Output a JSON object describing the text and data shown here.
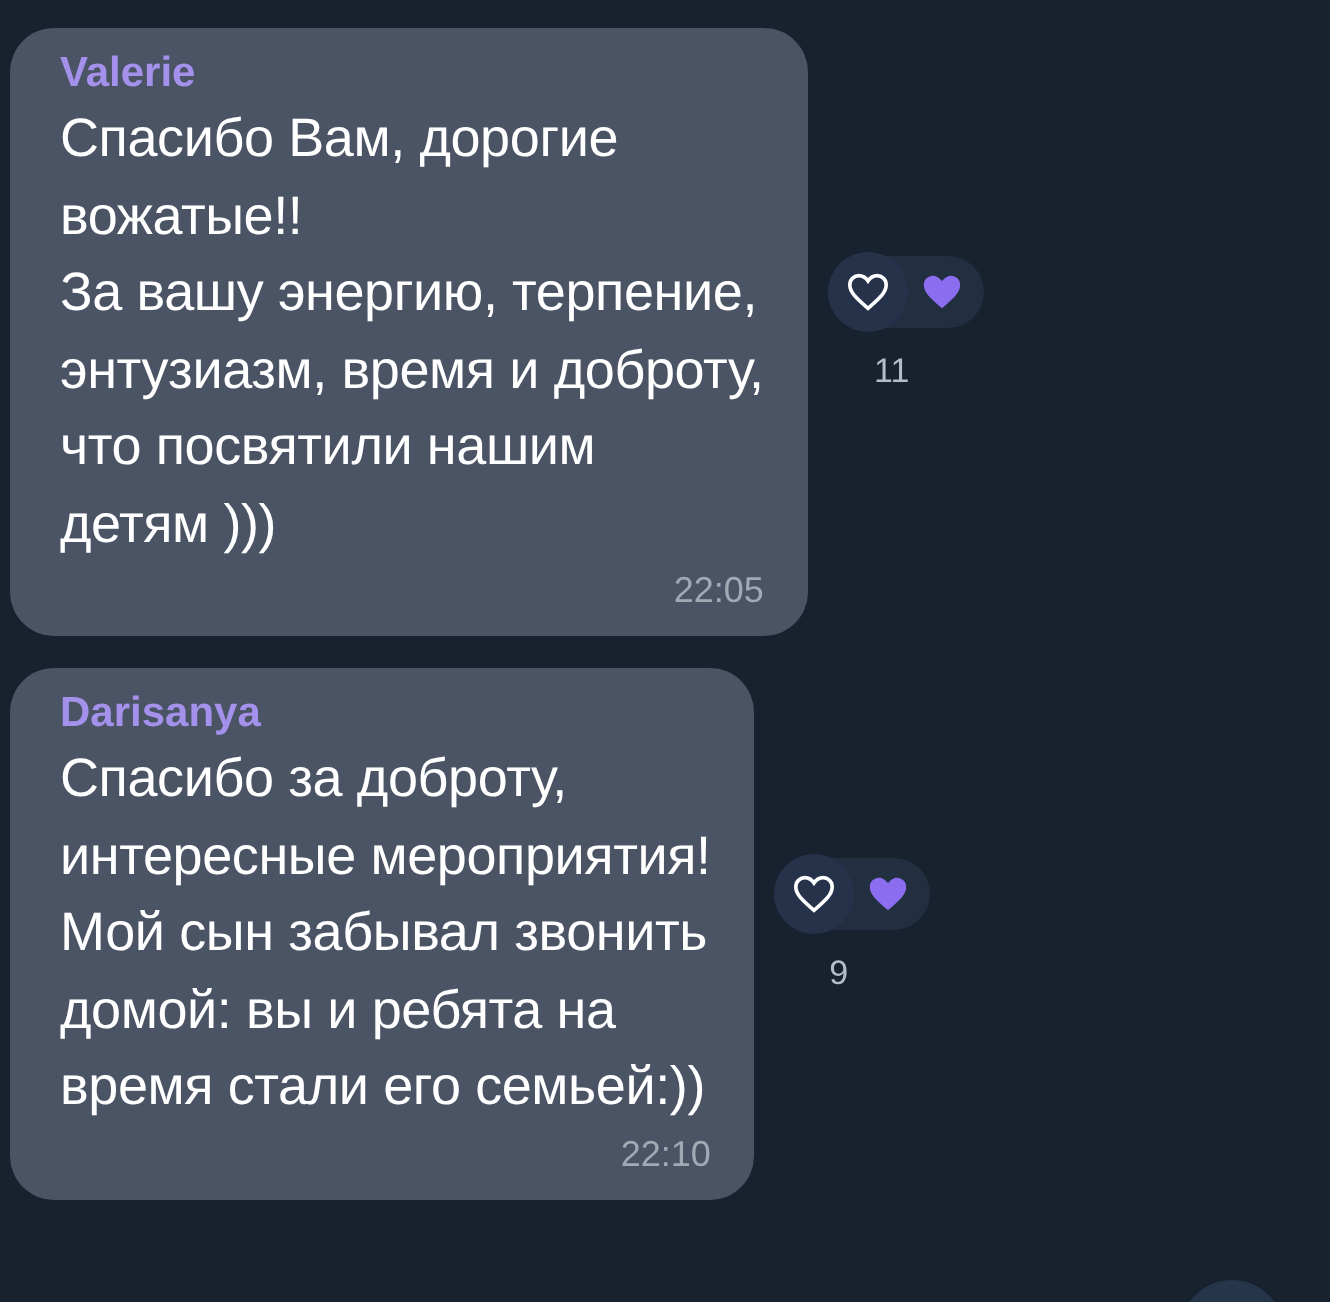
{
  "messages": [
    {
      "author": "Valerie",
      "text": "Спасибо Вам, дорогие\nвожатые!!\nЗа вашу энергию, терпение,\nэнтузиазм, время и доброту,\nчто посвятили нашим\nдетям )))",
      "time": "22:05",
      "reaction_count": "11"
    },
    {
      "author": "Darisanya",
      "text": "Спасибо за доброту,\nинтересные мероприятия!\nМой сын забывал звонить\nдомой: вы и ребята на\nвремя стали его семьей:))",
      "time": "22:10",
      "reaction_count": "9"
    }
  ]
}
